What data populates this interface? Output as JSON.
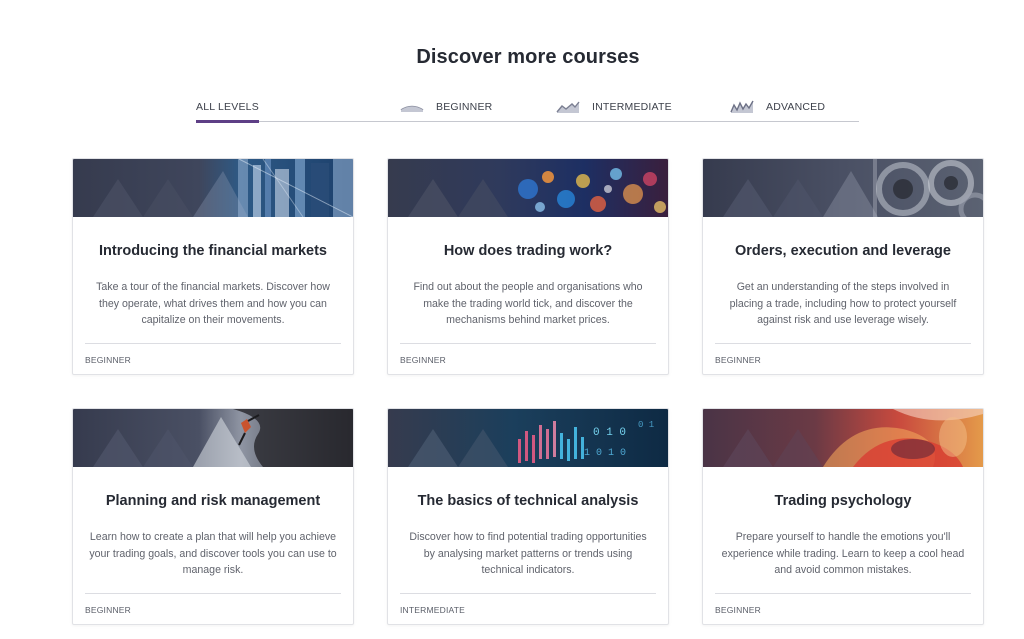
{
  "page": {
    "title": "Discover more courses"
  },
  "tabs": [
    {
      "label": "ALL LEVELS",
      "icon": "",
      "active": true
    },
    {
      "label": "BEGINNER",
      "icon": "beginner-wave-icon",
      "active": false
    },
    {
      "label": "INTERMEDIATE",
      "icon": "intermediate-trend-icon",
      "active": false
    },
    {
      "label": "ADVANCED",
      "icon": "advanced-trend-icon",
      "active": false
    }
  ],
  "courses": [
    {
      "title": "Introducing the financial markets",
      "description": "Take a tour of the financial markets. Discover how they operate, what drives them and how you can capitalize on their movements.",
      "level": "BEGINNER",
      "image": "glass-skyscrapers"
    },
    {
      "title": "How does trading work?",
      "description": "Find out about the people and organisations who make the trading world tick, and discover the mechanisms behind market prices.",
      "level": "BEGINNER",
      "image": "market-lights-bokeh"
    },
    {
      "title": "Orders, execution and leverage",
      "description": "Get an understanding of the steps involved in placing a trade, including how to protect yourself against risk and use leverage wisely.",
      "level": "BEGINNER",
      "image": "machine-gears"
    },
    {
      "title": "Planning and risk management",
      "description": "Learn how to create a plan that will help you achieve your trading goals, and discover tools you can use to manage risk.",
      "level": "BEGINNER",
      "image": "rock-climber"
    },
    {
      "title": "The basics of technical analysis",
      "description": "Discover how to find potential trading opportunities by analysing market patterns or trends using technical indicators.",
      "level": "INTERMEDIATE",
      "image": "digital-chart-data"
    },
    {
      "title": "Trading psychology",
      "description": "Prepare yourself to handle the emotions you'll experience while trading. Learn to keep a cool head and avoid common mistakes.",
      "level": "BEGINNER",
      "image": "abstract-mind"
    }
  ],
  "colors": {
    "accent": "#5e3f86",
    "banner": "#3b4053",
    "text": "#262a33",
    "muted": "#60636c"
  }
}
